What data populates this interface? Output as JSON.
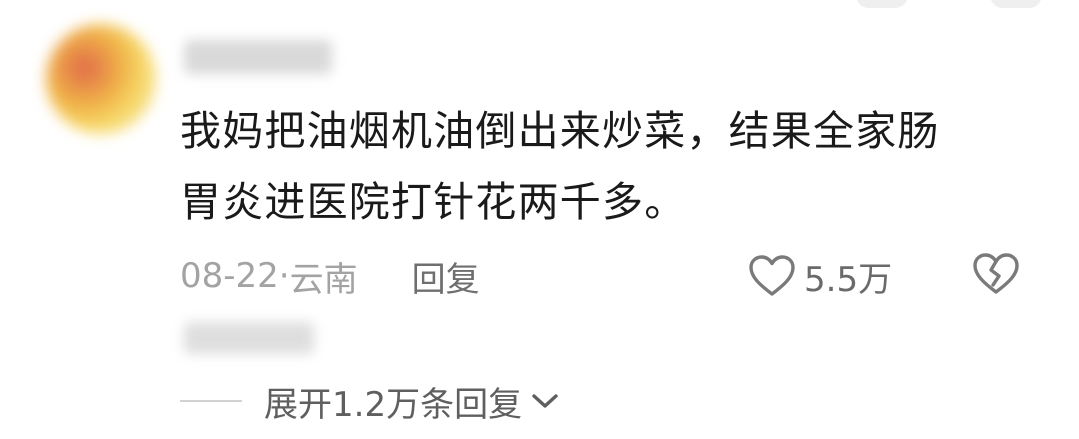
{
  "comment": {
    "lines": [
      "我妈把油烟机油倒出来炒菜，结果全家肠",
      "胃炎进医院打针花两千多。"
    ],
    "date": "08-22",
    "separator": " · ",
    "location": "云南",
    "reply_label": "回复",
    "like_count": "5.5万",
    "expand_label": "展开1.2万条回复"
  },
  "icons": {
    "like": "heart-outline-icon",
    "dislike": "broken-heart-icon",
    "expand": "chevron-down-icon"
  },
  "colors": {
    "text": "#1a1a1a",
    "meta": "#a3a3a3",
    "reply": "#6f6f6f",
    "icon": "#7a7a7a"
  }
}
